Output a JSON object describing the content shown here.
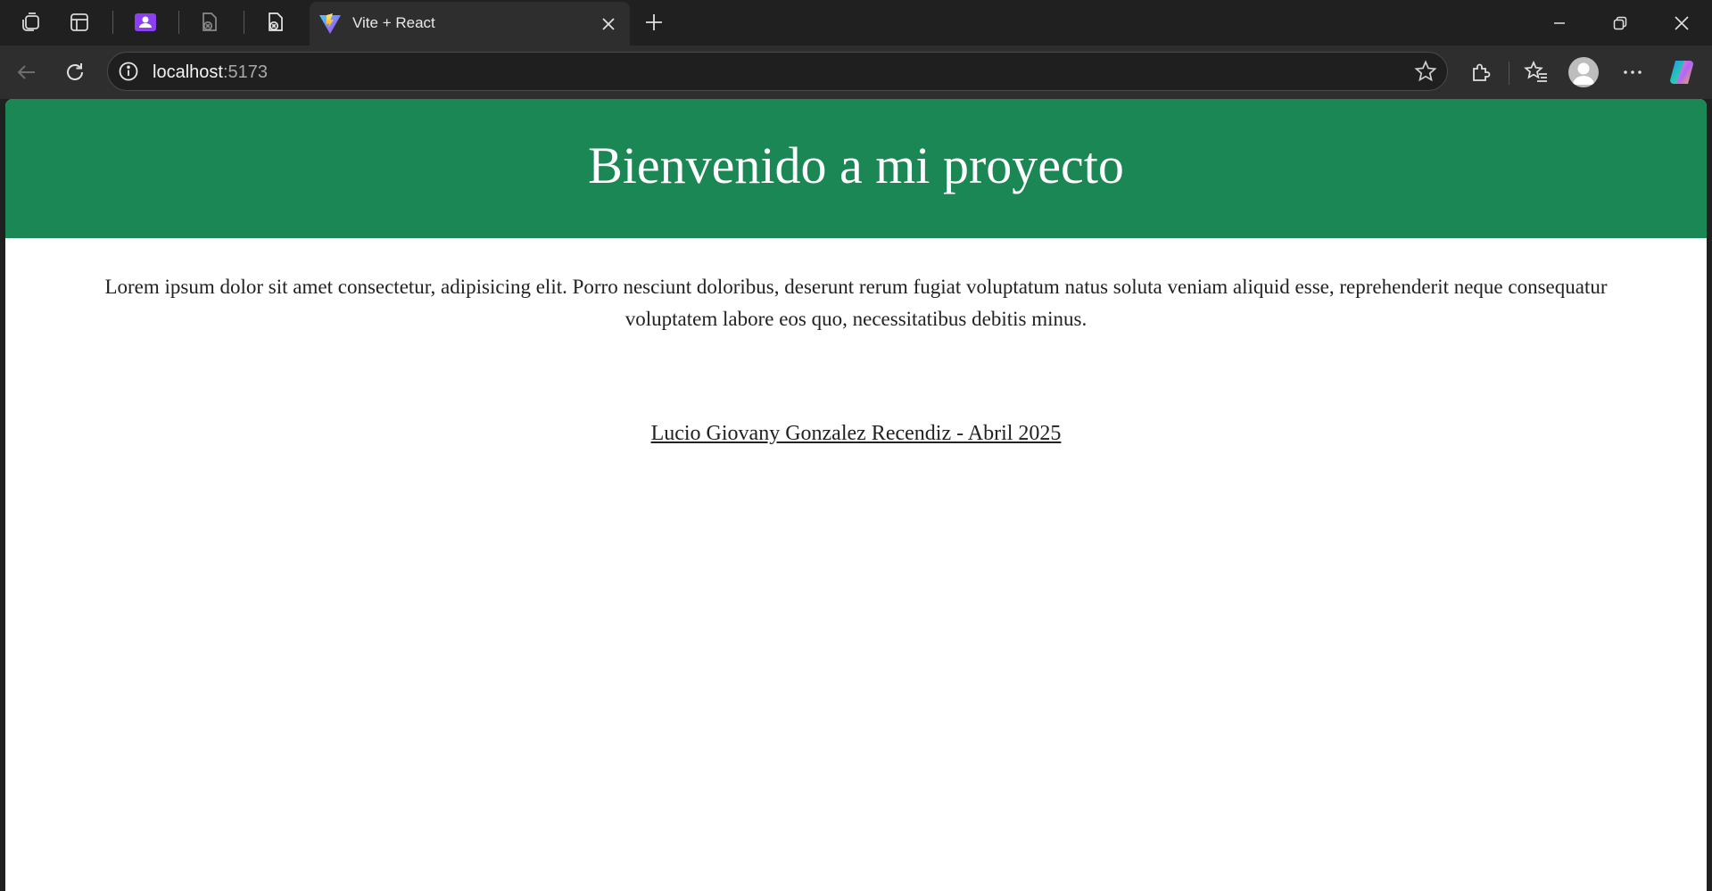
{
  "browser": {
    "tabs": [
      {
        "title": "Vite + React",
        "active": true
      }
    ],
    "address": {
      "host": "localhost",
      "port": ":5173"
    },
    "icons": {
      "workspaces": "workspaces-icon",
      "tab_actions": "tab-actions-icon",
      "profile_app": "profile-app-icon",
      "tab_pinned_1": "pdf-tab-icon",
      "tab_pinned_2": "pdf-tab-icon",
      "favicon": "vite-icon",
      "close": "close-icon",
      "new_tab": "plus-icon",
      "minimize": "minimize-icon",
      "restore": "restore-icon",
      "close_window": "close-icon",
      "back": "back-icon",
      "refresh": "refresh-icon",
      "info": "info-icon",
      "favorite": "star-icon",
      "extensions": "puzzle-icon",
      "favorites": "favorites-icon",
      "profile": "avatar-icon",
      "more": "more-icon",
      "copilot": "copilot-icon"
    },
    "colors": {
      "chrome_dark": "#202020",
      "toolbar": "#2e2e2e",
      "accent_purple": "#8a3ff0"
    }
  },
  "page": {
    "title": "Bienvenido a mi proyecto",
    "paragraph": "Lorem ipsum dolor sit amet consectetur, adipisicing elit. Porro nesciunt doloribus, deserunt rerum fugiat voluptatum natus soluta veniam aliquid esse, reprehenderit neque consequatur voluptatem labore eos quo, necessitatibus debitis minus.",
    "footer_link": "Lucio Giovany Gonzalez Recendiz - Abril 2025",
    "colors": {
      "header_bg": "#1b8755",
      "header_text": "#ffffff",
      "body_bg": "#ffffff",
      "body_text": "#222222"
    }
  }
}
